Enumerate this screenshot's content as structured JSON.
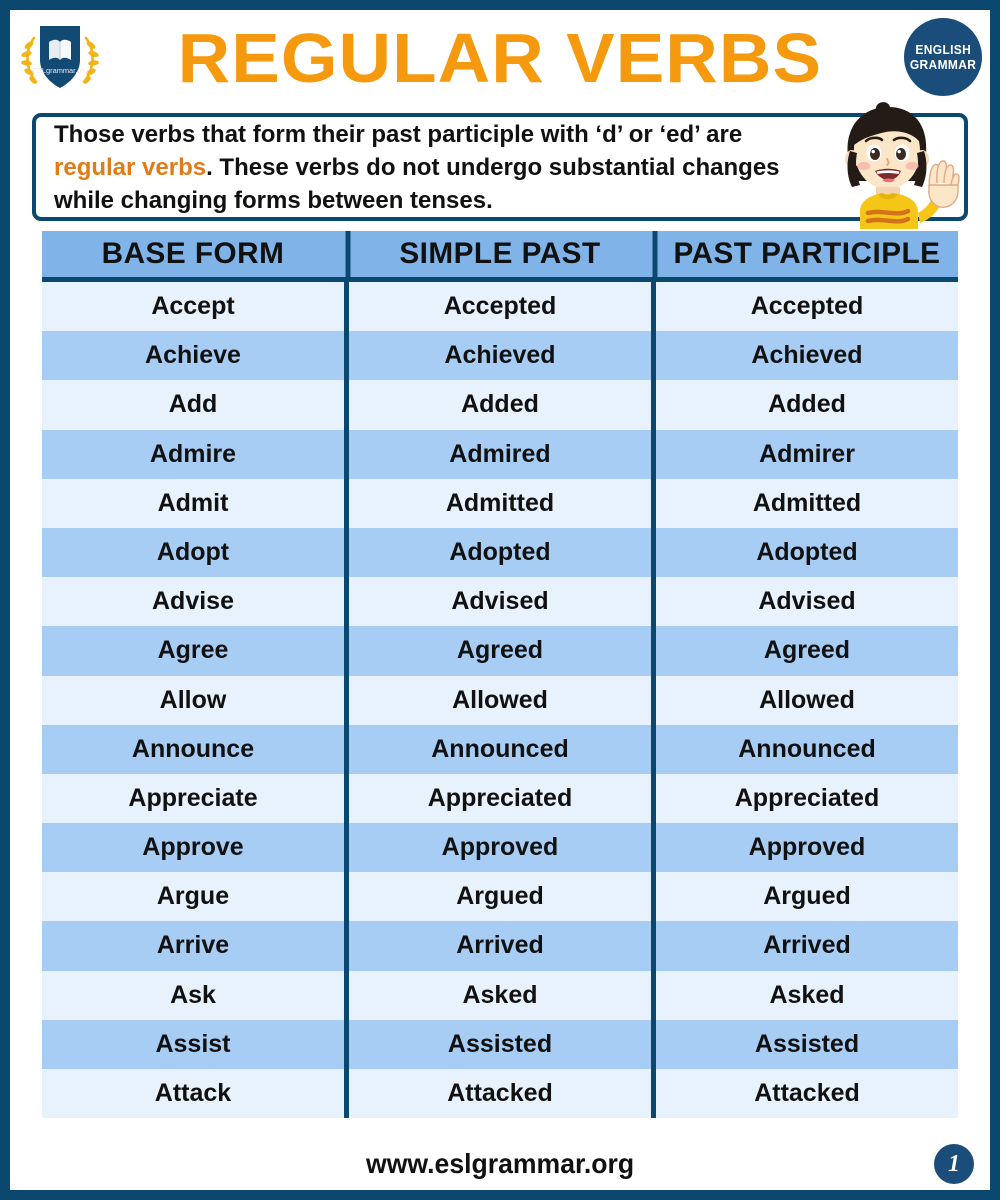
{
  "header": {
    "title": "REGULAR VERBS",
    "logo": {
      "icon": "eslgrammar-shield-logo",
      "caption": "ESLgrammar.org"
    },
    "badge": {
      "line1": "ENGLISH",
      "line2": "GRAMMAR"
    }
  },
  "definition": {
    "part1": "Those verbs that form their past participle with ‘d’ or ‘ed’ are ",
    "highlight1": "regular verbs",
    "part2": ". These verbs do not undergo substantial changes while changing forms between tenses.",
    "illustration": "waving-girl-icon"
  },
  "table": {
    "columns": [
      "BASE FORM",
      "SIMPLE PAST",
      "PAST PARTICIPLE"
    ],
    "rows": [
      [
        "Accept",
        "Accepted",
        "Accepted"
      ],
      [
        "Achieve",
        "Achieved",
        "Achieved"
      ],
      [
        "Add",
        "Added",
        "Added"
      ],
      [
        "Admire",
        "Admired",
        "Admirer"
      ],
      [
        "Admit",
        "Admitted",
        "Admitted"
      ],
      [
        "Adopt",
        "Adopted",
        "Adopted"
      ],
      [
        "Advise",
        "Advised",
        "Advised"
      ],
      [
        "Agree",
        "Agreed",
        "Agreed"
      ],
      [
        "Allow",
        "Allowed",
        "Allowed"
      ],
      [
        "Announce",
        "Announced",
        "Announced"
      ],
      [
        "Appreciate",
        "Appreciated",
        "Appreciated"
      ],
      [
        "Approve",
        "Approved",
        "Approved"
      ],
      [
        "Argue",
        "Argued",
        "Argued"
      ],
      [
        "Arrive",
        "Arrived",
        "Arrived"
      ],
      [
        "Ask",
        "Asked",
        "Asked"
      ],
      [
        "Assist",
        "Assisted",
        "Assisted"
      ],
      [
        "Attack",
        "Attacked",
        "Attacked"
      ]
    ]
  },
  "footer": {
    "url": "www.eslgrammar.org",
    "page_number": "1"
  },
  "colors": {
    "frame_navy": "#0b4870",
    "title_orange": "#F59A0E",
    "highlight_orange": "#E07B18",
    "header_row_blue": "#80B4E8",
    "row_light": "#E8F2FC",
    "row_dark": "#A8CDF5",
    "badge_navy": "#1A4D7A"
  }
}
